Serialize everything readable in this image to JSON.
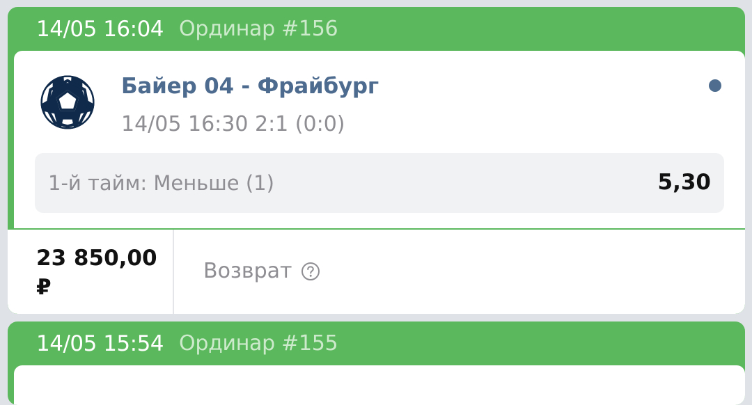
{
  "bets": [
    {
      "header": {
        "time": "14/05 16:04",
        "type": "Ординар #156"
      },
      "event": {
        "sport_icon": "soccer-ball-icon",
        "title": "Байер 04 - Фрайбург",
        "info": "14/05 16:30 2:1 (0:0)"
      },
      "outcome": {
        "label": "1-й тайм: Меньше (1)",
        "odds": "5,30"
      },
      "stake": "23 850,00 ₽",
      "result": "Возврат",
      "result_icon": "help-circle-icon"
    },
    {
      "header": {
        "time": "14/05 15:54",
        "type": "Ординар #155"
      }
    }
  ],
  "colors": {
    "header_green": "#5cb85c",
    "title_blue": "#4d6b8e",
    "status_dot": "#4f6d8f",
    "muted_text": "#8e8e93"
  }
}
